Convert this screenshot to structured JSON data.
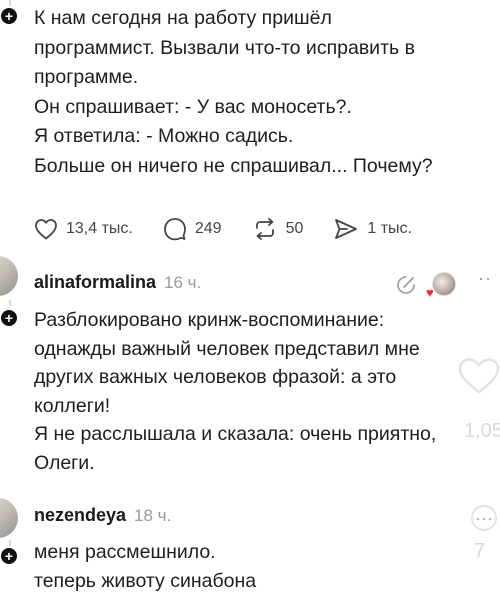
{
  "post": {
    "lines": [
      "К нам сегодня на работу пришёл",
      "программист. Вызвали что-то исправить в",
      "программе.",
      "Он спрашивает: - У вас моносеть?.",
      "Я ответила: - Можно садись.",
      "Больше он ничего не спрашивал... Почему?"
    ],
    "stats": {
      "likes": "13,4 тыс.",
      "comments": "249",
      "reposts": "50",
      "shares": "1 тыс."
    }
  },
  "comments": [
    {
      "username": "alinaformalina",
      "time": "16 ч.",
      "lines": [
        "Разблокировано кринж-воспоминание:",
        "однажды важный человек представил мне",
        "других важных человеков фразой: а это",
        "коллеги!",
        "Я не расслышала и сказала: очень приятно,",
        "Олеги."
      ],
      "like_count": "1,05"
    },
    {
      "username": "nezendeya",
      "time": "18 ч.",
      "lines": [
        "меня рассмешнило.",
        "теперь животу синабона"
      ],
      "like_count": "7"
    }
  ],
  "colors": {
    "text": "#1e1e1e",
    "muted": "#9a9a9a",
    "icon": "#444444",
    "heart_red": "#ed2a3a",
    "badge": "#111111"
  }
}
